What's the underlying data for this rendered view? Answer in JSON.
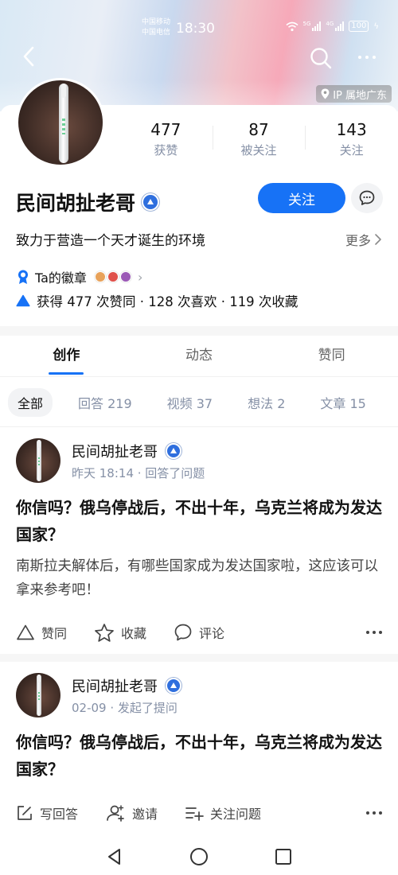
{
  "status_bar": {
    "carrier_1": "中国移动",
    "carrier_2": "中国电信",
    "time": "18:30",
    "net_tag_1": "5G",
    "net_tag_2": "4G",
    "battery": "100"
  },
  "header": {
    "ip_location": "IP 属地广东"
  },
  "profile": {
    "name": "民间胡扯老哥",
    "bio": "致力于营造一个天才诞生的环境",
    "more_label": "更多",
    "follow_label": "关注",
    "stats": [
      {
        "value": "477",
        "label": "获赞"
      },
      {
        "value": "87",
        "label": "被关注"
      },
      {
        "value": "143",
        "label": "关注"
      }
    ],
    "badges_label": "Ta的徽章",
    "badge_colors": [
      "#e8a25a",
      "#e0514b",
      "#9b59b6"
    ],
    "achievements": "获得 477 次赞同 · 128 次喜欢 · 119 次收藏"
  },
  "tabs": [
    {
      "label": "创作",
      "active": true
    },
    {
      "label": "动态",
      "active": false
    },
    {
      "label": "赞同",
      "active": false
    }
  ],
  "filters": [
    {
      "label": "全部",
      "active": true
    },
    {
      "label": "回答 219",
      "active": false
    },
    {
      "label": "视频 37",
      "active": false
    },
    {
      "label": "想法 2",
      "active": false
    },
    {
      "label": "文章 15",
      "active": false
    }
  ],
  "feed": [
    {
      "author": "民间胡扯老哥",
      "meta": "昨天 18:14 · 回答了问题",
      "title": "你信吗？俄乌停战后，不出十年，乌克兰将成为发达国家？",
      "excerpt": "南斯拉夫解体后，有哪些国家成为发达国家啦，这应该可以拿来参考吧！",
      "actions": {
        "upvote": "赞同",
        "favorite": "收藏",
        "comment": "评论"
      }
    },
    {
      "author": "民间胡扯老哥",
      "meta": "02-09 · 发起了提问",
      "title": "你信吗？俄乌停战后，不出十年，乌克兰将成为发达国家？",
      "actions": {
        "answer": "写回答",
        "invite": "邀请",
        "follow_question": "关注问题"
      }
    }
  ],
  "colors": {
    "accent": "#1772f6",
    "muted_text": "#8590a6"
  }
}
